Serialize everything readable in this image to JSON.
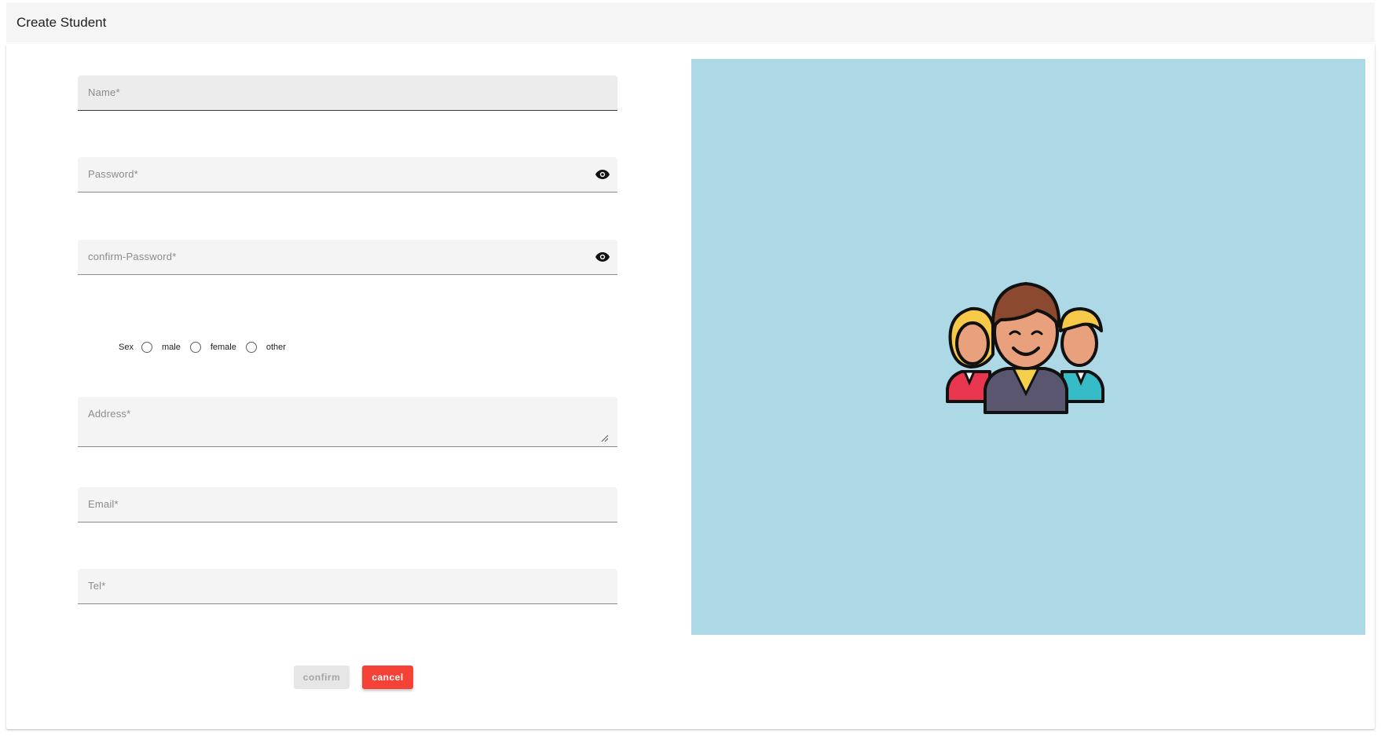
{
  "header": {
    "title": "Create Student"
  },
  "form": {
    "name_label": "Name*",
    "password_label": "Password*",
    "confirm_password_label": "confirm-Password*",
    "sex": {
      "label": "Sex",
      "options": [
        "male",
        "female",
        "other"
      ]
    },
    "address_label": "Address*",
    "email_label": "Email*",
    "tel_label": "Tel*"
  },
  "buttons": {
    "confirm_label": "confirm",
    "cancel_label": "cancel"
  },
  "image_panel": {
    "background": "#add8e6",
    "illustration": "students-group-icon"
  },
  "colors": {
    "accent_cancel": "#f44336",
    "disabled_button": "#e6e6e6"
  }
}
